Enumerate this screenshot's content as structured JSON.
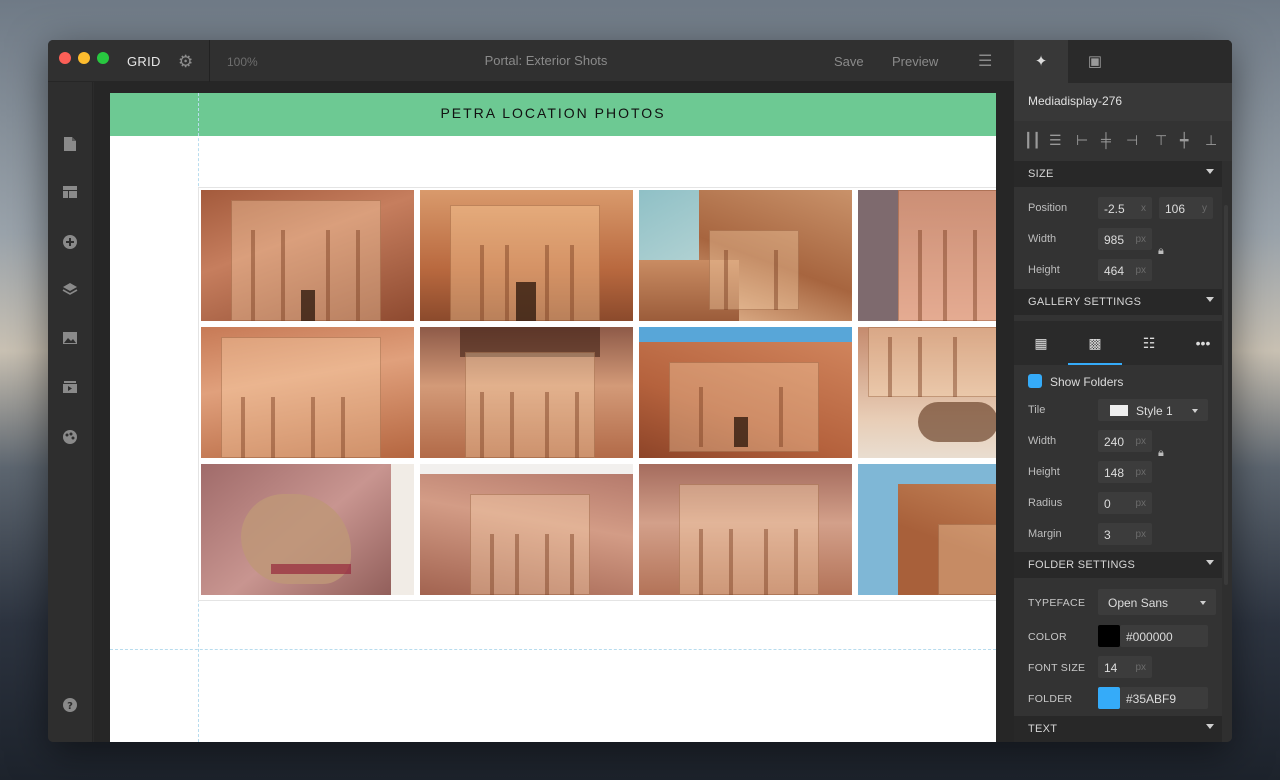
{
  "titlebar": {
    "app_name": "GRID",
    "zoom": "100%",
    "document_title": "Portal: Exterior Shots",
    "save_label": "Save",
    "preview_label": "Preview"
  },
  "page": {
    "header_title": "PETRA LOCATION PHOTOS"
  },
  "gallery": {
    "tiles": [
      {
        "name": "photo-monastery-facade"
      },
      {
        "name": "photo-treasury-low-angle"
      },
      {
        "name": "photo-treasury-sky"
      },
      {
        "name": "photo-treasury-columns"
      },
      {
        "name": "photo-treasury-front"
      },
      {
        "name": "photo-treasury-carved"
      },
      {
        "name": "photo-treasury-canyon"
      },
      {
        "name": "photo-camels-treasury"
      },
      {
        "name": "photo-camel-closeup"
      },
      {
        "name": "photo-treasury-wide"
      },
      {
        "name": "photo-treasury-angle"
      },
      {
        "name": "photo-cliff-sky"
      }
    ]
  },
  "panel": {
    "element_name": "Mediadisplay-276",
    "size": {
      "title": "SIZE",
      "position_label": "Position",
      "position_x": "-2.5",
      "position_x_unit": "x",
      "position_y": "106",
      "position_y_unit": "y",
      "width_label": "Width",
      "width": "985",
      "height_label": "Height",
      "height": "464",
      "unit": "px"
    },
    "gallery_settings": {
      "title": "GALLERY SETTINGS",
      "show_folders_label": "Show Folders",
      "tile_label": "Tile",
      "tile_style": "Style 1",
      "width_label": "Width",
      "width": "240",
      "height_label": "Height",
      "height": "148",
      "radius_label": "Radius",
      "radius": "0",
      "margin_label": "Margin",
      "margin": "3",
      "unit": "px"
    },
    "folder_settings": {
      "title": "FOLDER SETTINGS",
      "typeface_label": "TYPEFACE",
      "typeface": "Open Sans",
      "color_label": "COLOR",
      "color": "#000000",
      "font_size_label": "FONT SIZE",
      "font_size": "14",
      "folder_label": "FOLDER",
      "folder_color": "#35ABF9",
      "unit": "px"
    },
    "text": {
      "title": "TEXT"
    }
  },
  "colors": {
    "accent": "#35ABF9",
    "header_band": "#6dc993"
  }
}
